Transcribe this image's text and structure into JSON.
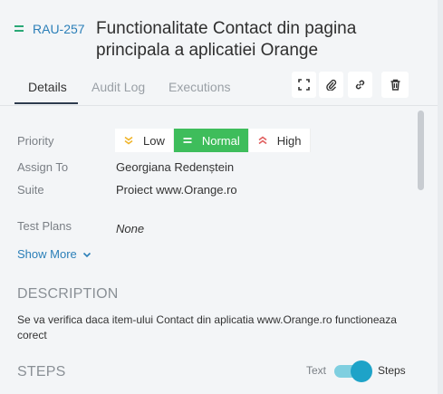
{
  "issue": {
    "key": "RAU-257",
    "title": "Functionalitate Contact din pagina principala a aplicatiei Orange"
  },
  "tabs": [
    {
      "label": "Details",
      "active": true
    },
    {
      "label": "Audit Log",
      "active": false
    },
    {
      "label": "Executions",
      "active": false
    }
  ],
  "toolbar": {
    "icons": [
      "fullscreen-icon",
      "paperclip-icon",
      "link-icon",
      "trash-icon"
    ]
  },
  "fields": {
    "priority_label": "Priority",
    "assign_label": "Assign To",
    "assign_value": "Georgiana Redenștein",
    "suite_label": "Suite",
    "suite_value": "Proiect www.Orange.ro",
    "testplans_label": "Test Plans",
    "testplans_value": "None"
  },
  "priority": {
    "options": [
      {
        "label": "Low",
        "color": "#f0b429"
      },
      {
        "label": "Normal",
        "color": "#3ebd5b"
      },
      {
        "label": "High",
        "color": "#e05d5d"
      }
    ],
    "selected": "Normal"
  },
  "show_more": "Show More",
  "description": {
    "title": "DESCRIPTION",
    "text": "Se va verifica daca item-ului Contact din aplicatia www.Orange.ro functioneaza corect"
  },
  "steps": {
    "title": "STEPS",
    "toggle_left": "Text",
    "toggle_right": "Steps",
    "toggle_on": true
  },
  "colors": {
    "accent_blue": "#2b7fb8",
    "accent_green": "#3ebd5b",
    "toggle": "#1ea3c8"
  }
}
